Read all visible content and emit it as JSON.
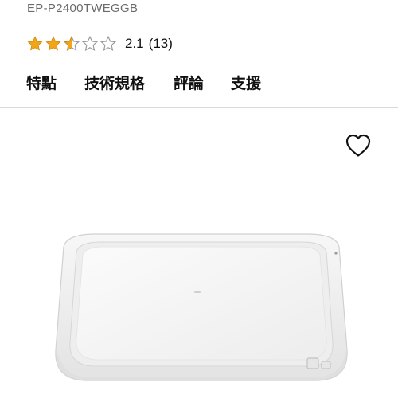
{
  "product": {
    "model_code": "EP-P2400TWEGGB"
  },
  "rating": {
    "value": "2.1",
    "count_open": "(",
    "count": "13",
    "count_close": ")",
    "stars_max": 5,
    "stars_value": 2.5,
    "star_color": "#f2a516",
    "star_empty_color": "#9a9a9a"
  },
  "tabs": [
    {
      "label": "特點"
    },
    {
      "label": "技術規格"
    },
    {
      "label": "評論"
    },
    {
      "label": "支援"
    }
  ],
  "wishlist": {
    "icon": "heart-icon"
  },
  "image": {
    "subject": "wireless-charger-pad",
    "color": "#f4f4f4"
  }
}
